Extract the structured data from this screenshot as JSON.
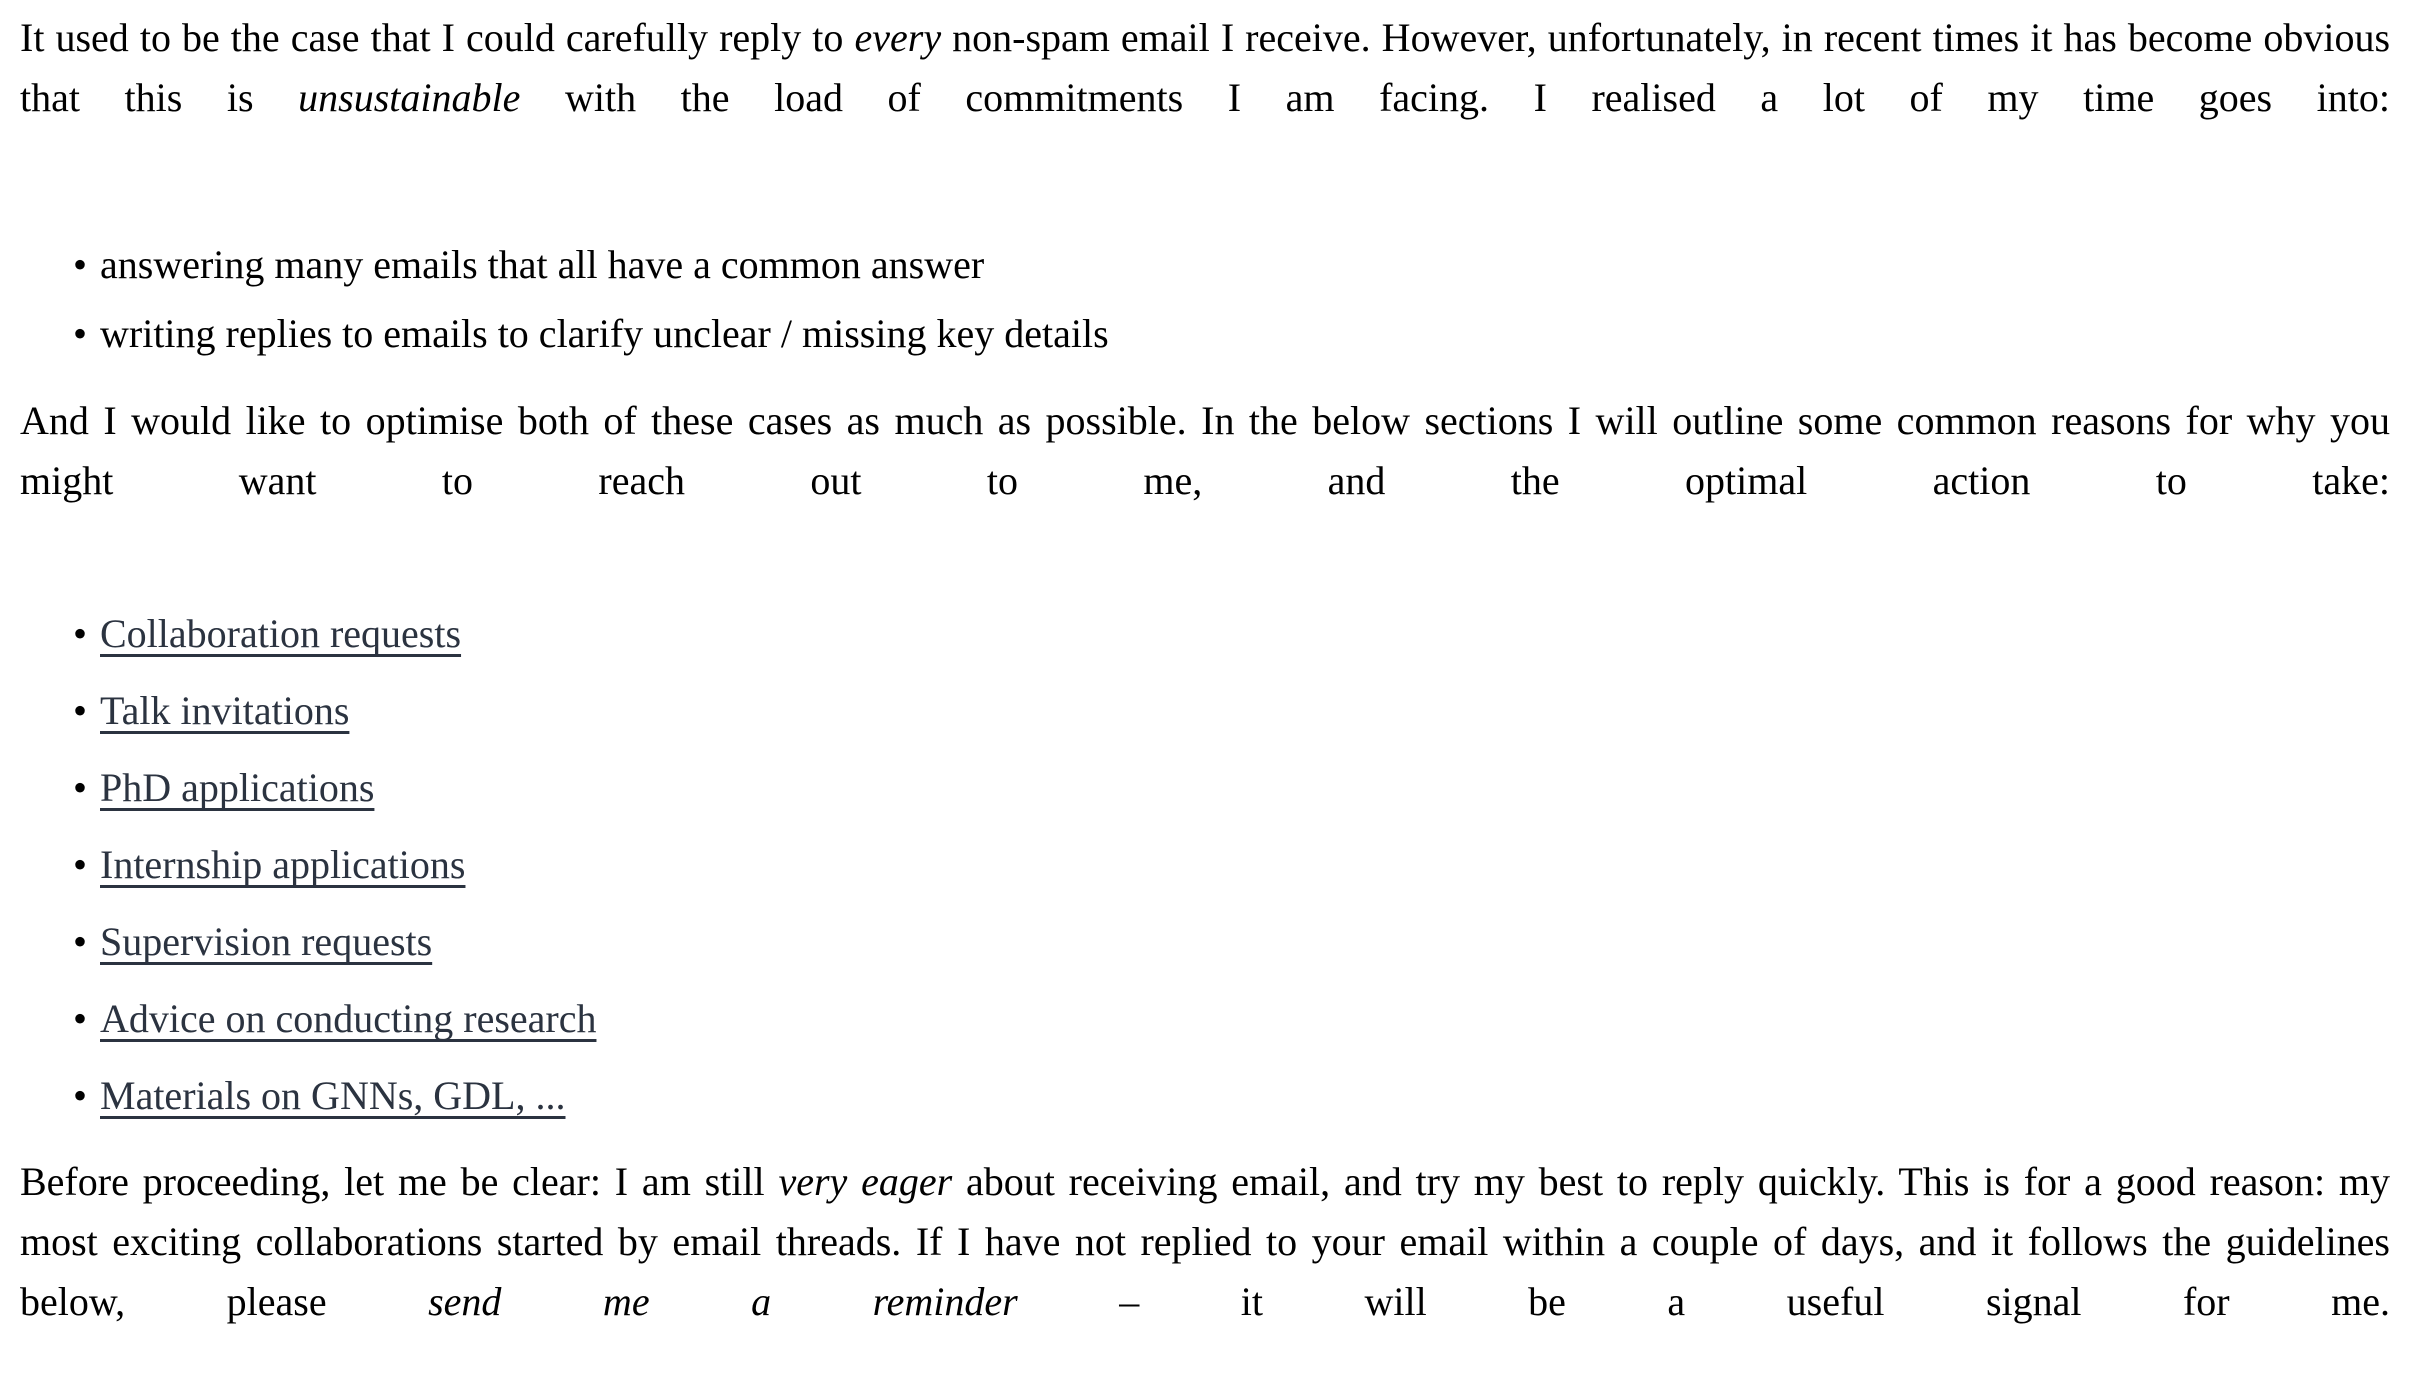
{
  "document": {
    "background_color": "#ffffff",
    "text_color": "#000000",
    "link_color": "#2b3340"
  },
  "paragraph_1": {
    "seg_1": "It used to be the case that I could carefully reply to ",
    "em_1": "every",
    "seg_2": " non-spam email I receive. However, unfortunately, in recent times it has become obvious that this is ",
    "em_2": "unsustainable",
    "seg_3": " with the load of commitments I am facing. I realised a lot of my time goes into:"
  },
  "list_1": {
    "bullet_glyph": "•",
    "items": [
      "answering many emails that all have a common answer",
      "writing replies to emails to clarify unclear / missing key details"
    ]
  },
  "paragraph_2": {
    "text": "And I would like to optimise both of these cases as much as possible. In the below sections I will outline some common reasons for why you might want to reach out to me, and the optimal action to take:"
  },
  "list_2": {
    "bullet_glyph": "•",
    "items": [
      {
        "label": "Collaboration requests"
      },
      {
        "label": "Talk invitations"
      },
      {
        "label": "PhD applications"
      },
      {
        "label": "Internship applications"
      },
      {
        "label": "Supervision requests"
      },
      {
        "label": "Advice on conducting research"
      },
      {
        "label": "Materials on GNNs, GDL, ..."
      }
    ]
  },
  "paragraph_3": {
    "seg_1": "Before proceeding, let me be clear: I am still ",
    "em_1": "very eager",
    "seg_2": " about receiving email, and try my best to reply quickly. This is for a good reason: my most exciting collaborations started by email threads. If I have not replied to your email within a couple of days, and it follows the guidelines below, please ",
    "em_2": "send me a reminder",
    "seg_3": " – it will be a useful signal for me."
  }
}
